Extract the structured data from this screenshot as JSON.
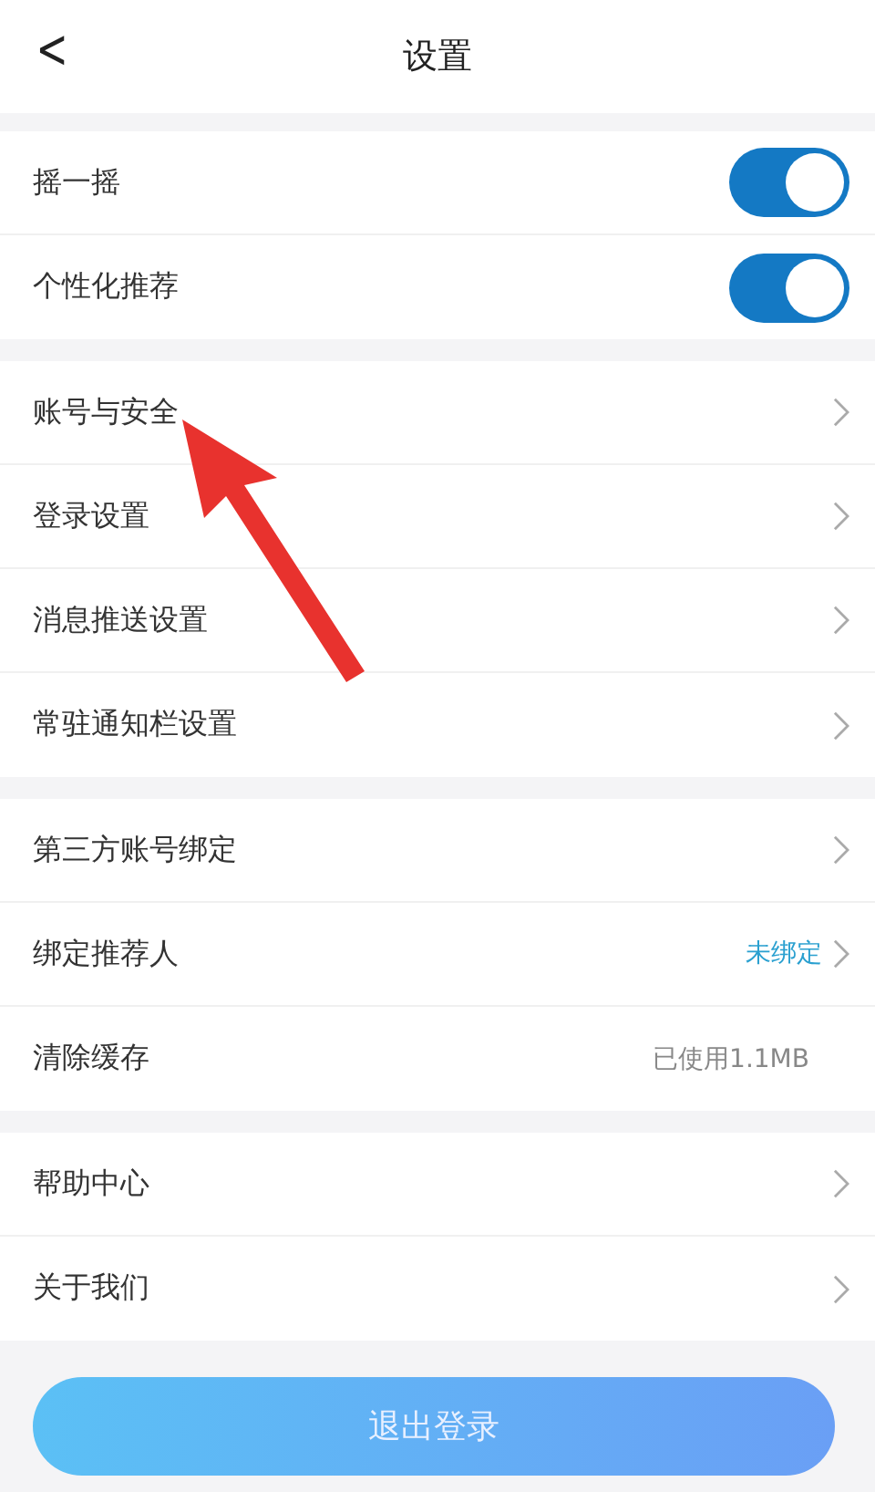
{
  "header": {
    "back": "<",
    "title": "设置"
  },
  "sections": [
    {
      "items": [
        {
          "kind": "toggle",
          "label": "摇一摇",
          "on": true
        },
        {
          "kind": "toggle",
          "label": "个性化推荐",
          "on": true
        }
      ]
    },
    {
      "items": [
        {
          "kind": "link",
          "label": "账号与安全"
        },
        {
          "kind": "link",
          "label": "登录设置"
        },
        {
          "kind": "link",
          "label": "消息推送设置"
        },
        {
          "kind": "link",
          "label": "常驻通知栏设置"
        }
      ]
    },
    {
      "items": [
        {
          "kind": "link",
          "label": "第三方账号绑定"
        },
        {
          "kind": "link",
          "label": "绑定推荐人",
          "value": "未绑定"
        },
        {
          "kind": "value",
          "label": "清除缓存",
          "value": "已使用1.1MB"
        }
      ]
    },
    {
      "items": [
        {
          "kind": "link",
          "label": "帮助中心"
        },
        {
          "kind": "link",
          "label": "关于我们"
        }
      ]
    }
  ],
  "logout_button": "退出登录"
}
